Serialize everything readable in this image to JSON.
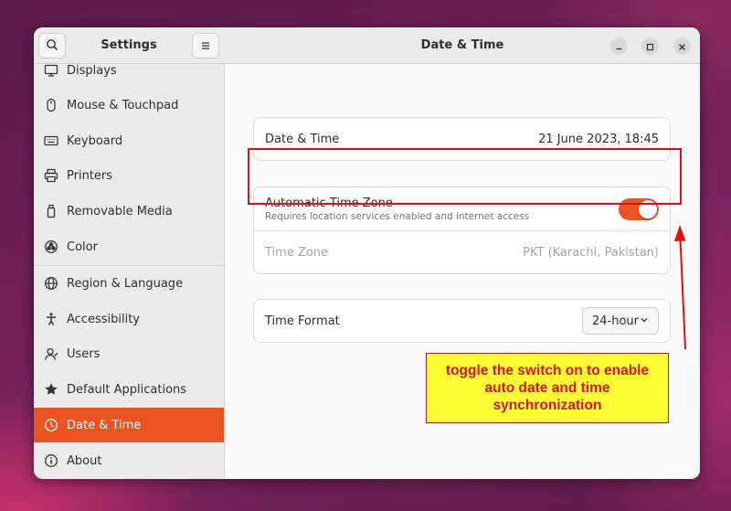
{
  "sidebar": {
    "title": "Settings",
    "items": [
      {
        "label": "Displays",
        "icon": "display-icon"
      },
      {
        "label": "Mouse & Touchpad",
        "icon": "mouse-icon"
      },
      {
        "label": "Keyboard",
        "icon": "keyboard-icon"
      },
      {
        "label": "Printers",
        "icon": "printer-icon"
      },
      {
        "label": "Removable Media",
        "icon": "removable-media-icon"
      },
      {
        "label": "Color",
        "icon": "color-icon"
      },
      {
        "label": "Region & Language",
        "icon": "globe-icon"
      },
      {
        "label": "Accessibility",
        "icon": "accessibility-icon"
      },
      {
        "label": "Users",
        "icon": "users-icon"
      },
      {
        "label": "Default Applications",
        "icon": "star-icon"
      },
      {
        "label": "Date & Time",
        "icon": "clock-icon",
        "active": true
      },
      {
        "label": "About",
        "icon": "info-icon"
      }
    ]
  },
  "header": {
    "title": "Date & Time"
  },
  "date_card": {
    "label": "Date & Time",
    "value": "21 June 2023, 18:45"
  },
  "timezone_card": {
    "auto_label": "Automatic Time Zone",
    "auto_subtitle": "Requires location services enabled and internet access",
    "auto_enabled": true,
    "tz_label": "Time Zone",
    "tz_value": "PKT (Karachi, Pakistan)"
  },
  "format_card": {
    "label": "Time Format",
    "value": "24-hour"
  },
  "annotation": {
    "text": "toggle the switch on to enable auto date and time synchronization"
  },
  "colors": {
    "accent": "#e95420",
    "annotation_red": "#e01010",
    "annotation_yellow": "#ffff33"
  }
}
